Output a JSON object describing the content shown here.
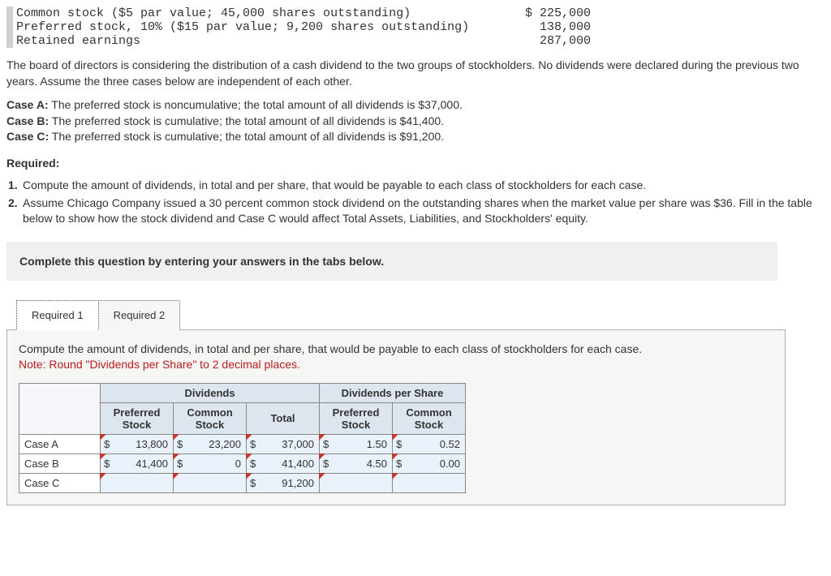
{
  "stock_info": {
    "rows": [
      {
        "label": "Common stock ($5 par value; 45,000 shares outstanding)",
        "value": "$ 225,000"
      },
      {
        "label": "Preferred stock, 10% ($15 par value; 9,200 shares outstanding)",
        "value": "138,000"
      },
      {
        "label": "Retained earnings",
        "value": "287,000"
      }
    ]
  },
  "intro": "The board of directors is considering the distribution of a cash dividend to the two groups of stockholders. No dividends were declared during the previous two years. Assume the three cases below are independent of each other.",
  "cases": {
    "a": {
      "label": "Case A:",
      "text": " The preferred stock is noncumulative; the total amount of all dividends is $37,000."
    },
    "b": {
      "label": "Case B:",
      "text": " The preferred stock is cumulative; the total amount of all dividends is $41,400."
    },
    "c": {
      "label": "Case C:",
      "text": " The preferred stock is cumulative; the total amount of all dividends is $91,200."
    }
  },
  "required_heading": "Required:",
  "requirements": [
    {
      "num": "1.",
      "text": "Compute the amount of dividends, in total and per share, that would be payable to each class of stockholders for each case."
    },
    {
      "num": "2.",
      "text": "Assume Chicago Company issued a 30 percent common stock dividend on the outstanding shares when the market value per share was $36. Fill in the table below to show how the stock dividend and Case C would affect Total Assets, Liabilities, and Stockholders' equity."
    }
  ],
  "instruction_box": "Complete this question by entering your answers in the tabs below.",
  "tabs": {
    "r1": "Required 1",
    "r2": "Required 2"
  },
  "tab_content": {
    "instruction": "Compute the amount of dividends, in total and per share, that would be payable to each class of stockholders for each case.",
    "note": "Note: Round \"Dividends per Share\" to 2 decimal places."
  },
  "table": {
    "group_headers": [
      "Dividends",
      "Dividends per Share"
    ],
    "headers": [
      "Preferred Stock",
      "Common Stock",
      "Total",
      "Preferred Stock",
      "Common Stock"
    ],
    "rows": [
      {
        "label": "Case A",
        "pref": "13,800",
        "comm": "23,200",
        "total": "37,000",
        "pref_ps": "1.50",
        "comm_ps": "0.52"
      },
      {
        "label": "Case B",
        "pref": "41,400",
        "comm": "0",
        "total": "41,400",
        "pref_ps": "4.50",
        "comm_ps": "0.00"
      },
      {
        "label": "Case C",
        "pref": "",
        "comm": "",
        "total": "91,200",
        "pref_ps": "",
        "comm_ps": ""
      }
    ]
  }
}
